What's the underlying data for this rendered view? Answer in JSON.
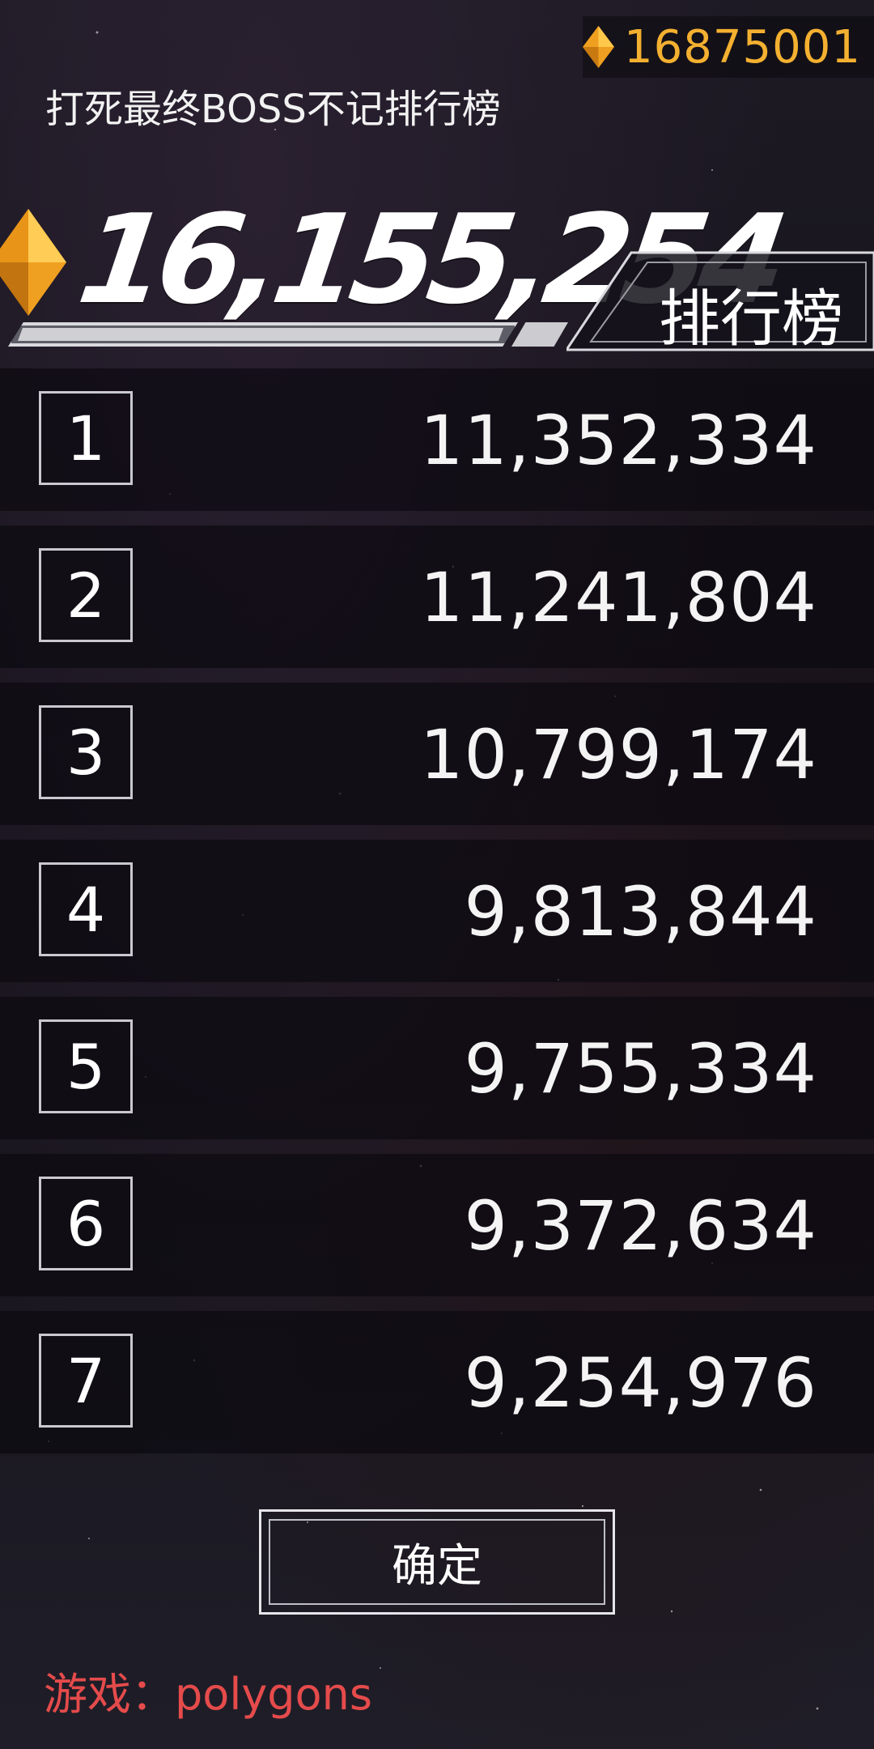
{
  "currency": {
    "amount": "16875001",
    "icon": "gem-icon",
    "color": "#f4b030"
  },
  "notice": "打死最终BOSS不记排行榜",
  "score": {
    "value": "16,155,254",
    "icon": "gem-icon"
  },
  "tab": {
    "label": "排行榜"
  },
  "leaderboard": [
    {
      "rank": "1",
      "score": "11,352,334"
    },
    {
      "rank": "2",
      "score": "11,241,804"
    },
    {
      "rank": "3",
      "score": "10,799,174"
    },
    {
      "rank": "4",
      "score": "9,813,844"
    },
    {
      "rank": "5",
      "score": "9,755,334"
    },
    {
      "rank": "6",
      "score": "9,372,634"
    },
    {
      "rank": "7",
      "score": "9,254,976"
    }
  ],
  "confirm_label": "确定",
  "watermark": "游戏：polygons"
}
